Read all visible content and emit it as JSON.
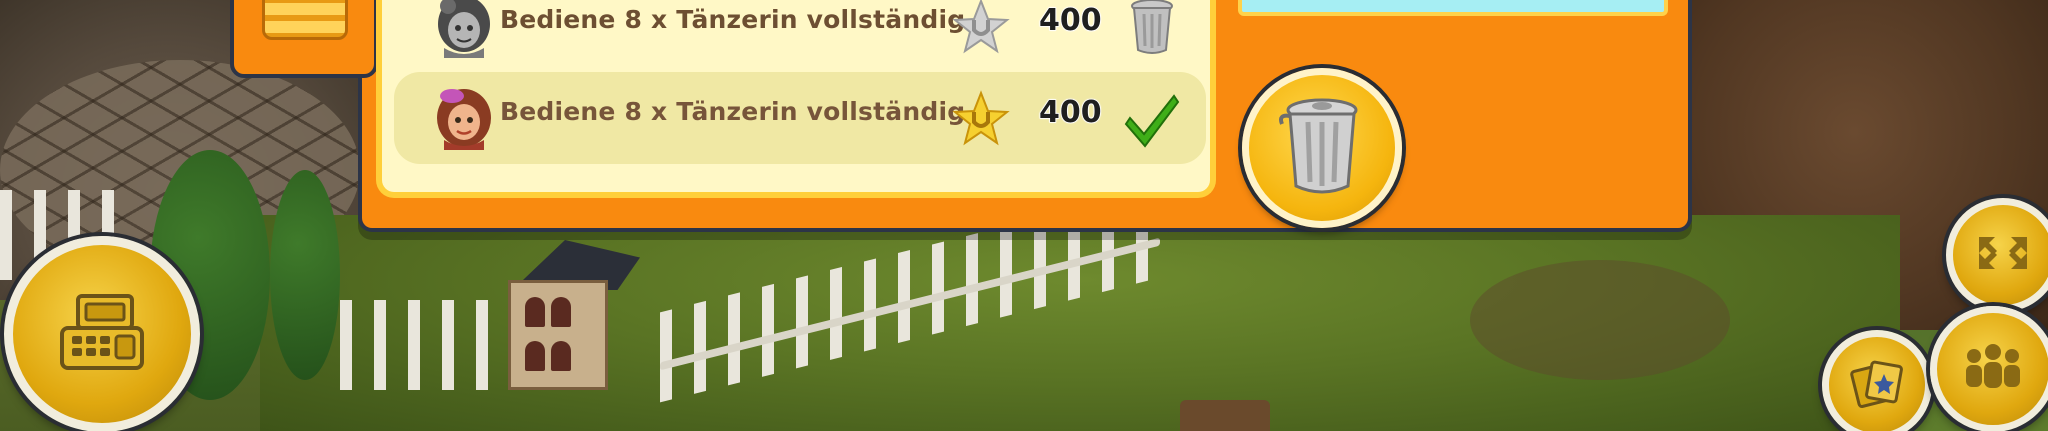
{
  "orders": {
    "rows": [
      {
        "text": "Bediene 8 x Tänzerin vollständig",
        "reward": "400",
        "status": "pending",
        "action_icon": "trash-icon"
      },
      {
        "text": "Bediene 8 x Tänzerin vollständig",
        "reward": "400",
        "status": "completed",
        "action_icon": "checkmark-icon"
      }
    ]
  },
  "icons": {
    "left_button": "cash-register-icon",
    "delete_button": "trash-icon",
    "right_top_button": "expand-arrows-icon",
    "right_bottom_left_button": "cards-icon",
    "right_bottom_right_button": "people-icon"
  },
  "colors": {
    "panel_orange": "#f98a0f",
    "list_bg": "#fff8c6",
    "active_row": "#f0e8a4",
    "gold": "#f5b50e",
    "check_green": "#3fae18"
  }
}
